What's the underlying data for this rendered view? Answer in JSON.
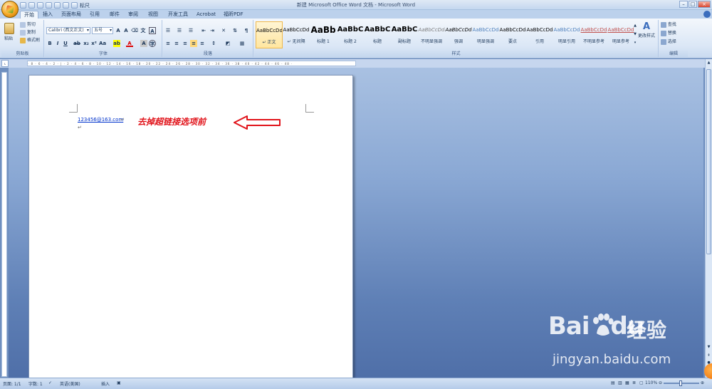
{
  "window": {
    "title": "新建 Microsoft Office Word 文档 - Microsoft Word",
    "qat_checkbox_label": "标尺"
  },
  "tabs": [
    "开始",
    "插入",
    "页面布局",
    "引用",
    "邮件",
    "审阅",
    "视图",
    "开发工具",
    "Acrobat",
    "福昕PDF"
  ],
  "ribbon": {
    "clipboard": {
      "paste": "粘贴",
      "cut": "剪切",
      "copy": "复制",
      "format_painter": "格式刷",
      "label": "剪贴板"
    },
    "font": {
      "font_name": "Calibri (西文正文)",
      "font_size": "五号",
      "label": "字体"
    },
    "paragraph": {
      "label": "段落"
    },
    "styles": {
      "label": "样式",
      "items": [
        {
          "sample": "AaBbCcDd",
          "name": "↵ 正文",
          "color": "#000000"
        },
        {
          "sample": "AaBbCcDd",
          "name": "↵ 无间隔",
          "color": "#000000"
        },
        {
          "sample": "AaBb",
          "name": "标题 1",
          "color": "#000000"
        },
        {
          "sample": "AaBbC",
          "name": "标题 2",
          "color": "#000000"
        },
        {
          "sample": "AaBbC",
          "name": "标题",
          "color": "#000000"
        },
        {
          "sample": "AaBbC",
          "name": "副标题",
          "color": "#000000"
        },
        {
          "sample": "AaBbCcDd",
          "name": "不明显强调",
          "color": "#808080"
        },
        {
          "sample": "AaBbCcDd",
          "name": "强调",
          "color": "#000000"
        },
        {
          "sample": "AaBbCcDd",
          "name": "明显强调",
          "color": "#4f81bd"
        },
        {
          "sample": "AaBbCcDd",
          "name": "要点",
          "color": "#000000"
        },
        {
          "sample": "AaBbCcDd",
          "name": "引用",
          "color": "#000000"
        },
        {
          "sample": "AaBbCcDd",
          "name": "明显引用",
          "color": "#4f81bd"
        },
        {
          "sample": "AaBbCcDd",
          "name": "不明显参考",
          "color": "#c0504d"
        },
        {
          "sample": "AaBbCcDd",
          "name": "明显参考",
          "color": "#c0504d"
        }
      ],
      "change_styles": "更改样式"
    },
    "editing": {
      "find": "查找",
      "replace": "替换",
      "select": "选择",
      "label": "编辑"
    }
  },
  "document": {
    "hyperlink_text": "123456@163.com",
    "annotation": "去掉超链接选项前"
  },
  "status": {
    "page": "页面: 1/1",
    "words": "字数: 1",
    "language": "英语(美国)",
    "mode": "插入",
    "zoom": "110%"
  },
  "watermark": {
    "logo": "Bai",
    "logo2": "du",
    "cn": "经验",
    "url": "jingyan.baidu.com"
  },
  "colors": {
    "hyperlink": "#0033cc",
    "annotation": "#e1141b",
    "ribbon_bg": "#dbe7f6"
  }
}
